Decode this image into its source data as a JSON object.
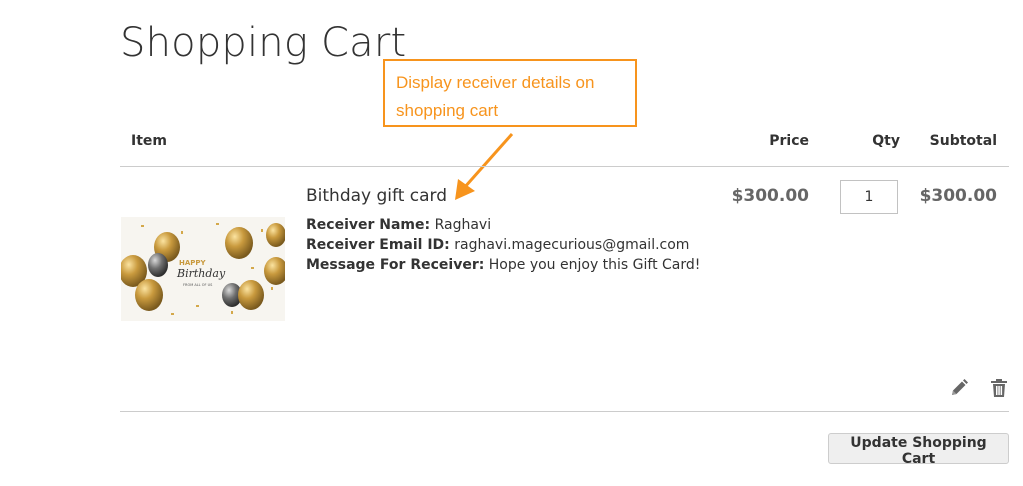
{
  "page": {
    "title": "Shopping Cart"
  },
  "callout": {
    "text": "Display receiver details on shopping cart"
  },
  "table": {
    "headers": {
      "item": "Item",
      "price": "Price",
      "qty": "Qty",
      "subtotal": "Subtotal"
    }
  },
  "cart_item": {
    "name": "Bithday gift card",
    "image": {
      "text_line1": "HAPPY",
      "text_line2": "Birthday",
      "text_line3": "FROM ALL OF US"
    },
    "options": [
      {
        "label": "Receiver Name:",
        "value": "Raghavi"
      },
      {
        "label": "Receiver Email ID:",
        "value": "raghavi.magecurious@gmail.com"
      },
      {
        "label": "Message For Receiver:",
        "value": "Hope you enjoy this Gift Card!"
      }
    ],
    "price": "$300.00",
    "qty": "1",
    "subtotal": "$300.00",
    "actions": {
      "edit_icon": "pencil-icon",
      "delete_icon": "trash-icon"
    }
  },
  "buttons": {
    "update_cart": "Update Shopping Cart"
  },
  "colors": {
    "callout": "#f7941d",
    "price": "#666666",
    "text": "#333333"
  }
}
